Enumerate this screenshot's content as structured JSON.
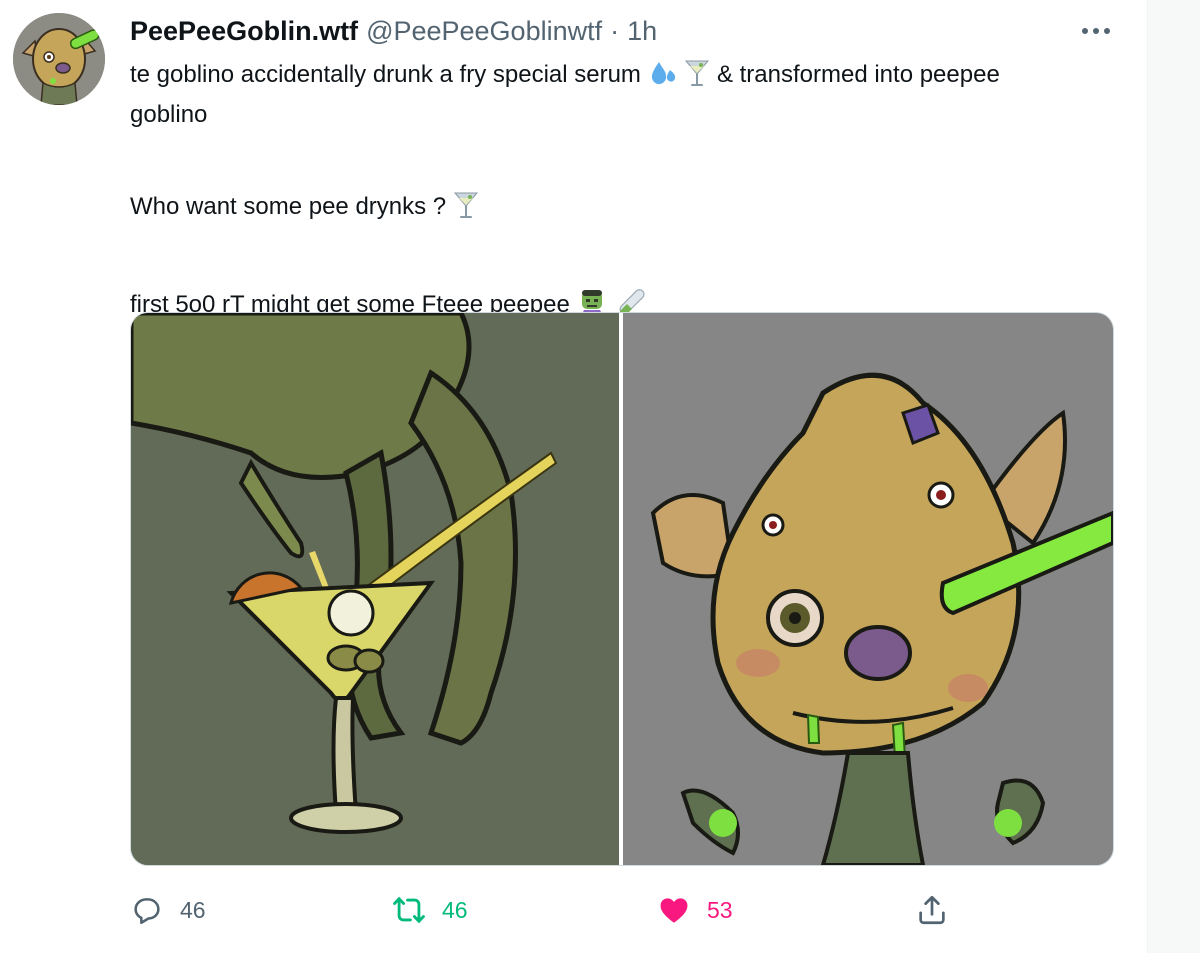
{
  "tweet": {
    "author": {
      "name": "PeePeeGoblin.wtf",
      "handle": "@PeePeeGoblinwtf",
      "separator": "·",
      "time": "1h",
      "avatar_icon": "goblin-avatar"
    },
    "body": {
      "line1_part1": "te goblino accidentally drunk a fry special serum",
      "line1_part2": "& transformed into peepee",
      "line2": "goblino",
      "line3": "Who want some pee drynks ?",
      "line4": "first 5o0 rT might get some Fteee peepee",
      "emojis": [
        "sweat-droplets-icon",
        "cocktail-glass-icon",
        "cocktail-glass-icon",
        "zombie-icon",
        "test-tube-icon"
      ]
    },
    "media": {
      "images": [
        "goblin-pouring-cocktail-illustration",
        "goblin-drinking-serum-illustration"
      ]
    },
    "actions": {
      "reply_count": "46",
      "retweet_count": "46",
      "like_count": "53"
    },
    "colors": {
      "text": "#0f1419",
      "secondary": "#536471",
      "retweet": "#00ba7c",
      "like": "#f91880"
    }
  }
}
